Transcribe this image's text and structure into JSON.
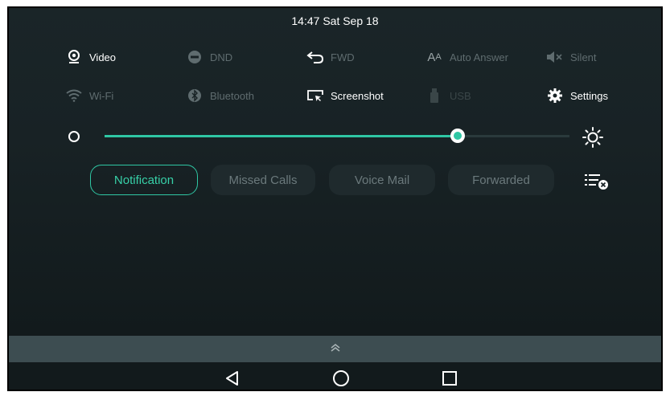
{
  "status": {
    "time": "14:47 Sat Sep 18"
  },
  "quick_settings": {
    "video": "Video",
    "dnd": "DND",
    "fwd": "FWD",
    "auto_answer": "Auto Answer",
    "silent": "Silent",
    "wifi": "Wi-Fi",
    "bluetooth": "Bluetooth",
    "screenshot": "Screenshot",
    "usb": "USB",
    "settings": "Settings"
  },
  "brightness": {
    "level": 0.76
  },
  "tabs": [
    "Notification",
    "Missed Calls",
    "Voice Mail",
    "Forwarded"
  ],
  "active_tab": "Notification",
  "colors": {
    "accent": "#2fc7a4",
    "background": "#182225",
    "disabled_text": "#5f6c6f"
  },
  "icons": {
    "video": "webcam-icon",
    "dnd": "dnd-icon",
    "fwd": "forward-icon",
    "auto_answer": "auto-answer-icon",
    "silent": "mute-icon",
    "wifi": "wifi-icon",
    "bluetooth": "bluetooth-icon",
    "screenshot": "screenshot-icon",
    "usb": "usb-icon",
    "settings": "gear-icon",
    "clear": "clear-all-icon",
    "nav_back": "back-icon",
    "nav_home": "home-icon",
    "nav_recent": "recent-apps-icon"
  }
}
